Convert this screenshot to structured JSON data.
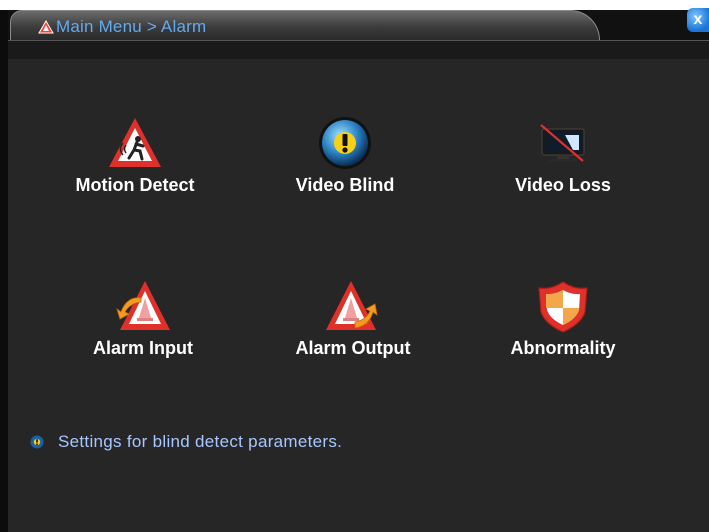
{
  "window": {
    "breadcrumb": "Main Menu > Alarm",
    "close_label": "x"
  },
  "menu": {
    "items": [
      {
        "label": "Motion Detect",
        "icon": "motion-detect-icon"
      },
      {
        "label": "Video Blind",
        "icon": "video-blind-icon"
      },
      {
        "label": "Video Loss",
        "icon": "video-loss-icon"
      },
      {
        "label": "Alarm Input",
        "icon": "alarm-input-icon"
      },
      {
        "label": "Alarm Output",
        "icon": "alarm-output-icon"
      },
      {
        "label": "Abnormality",
        "icon": "abnormality-icon"
      }
    ]
  },
  "status": {
    "hint": "Settings for blind detect parameters.",
    "hint_icon": "info-icon"
  },
  "colors": {
    "title_text": "#62aaf0",
    "hint_text": "#a9c7ff",
    "background": "#262626",
    "warning_red": "#e0302a"
  }
}
